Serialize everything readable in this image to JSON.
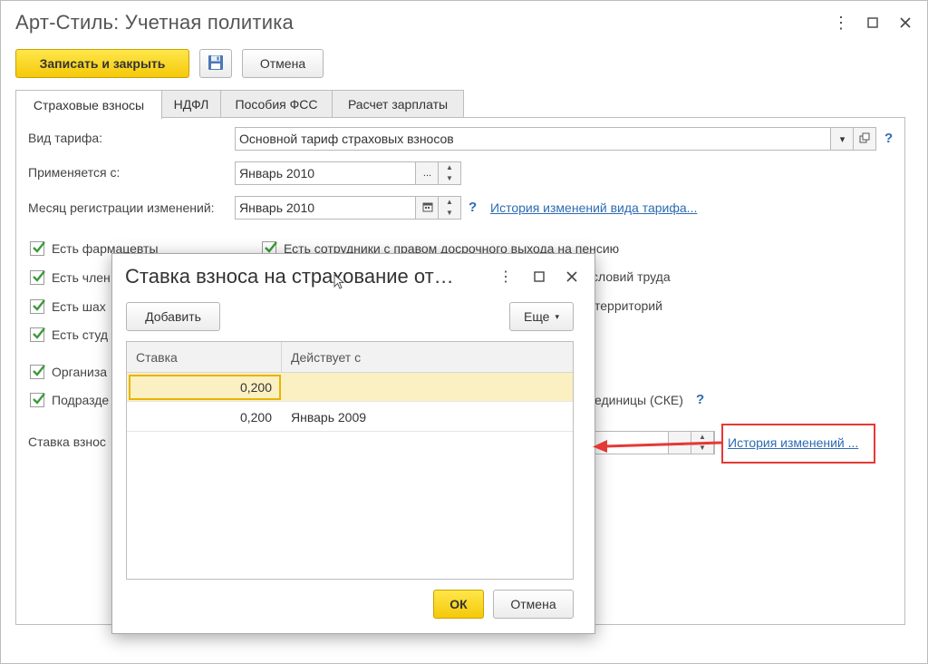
{
  "window": {
    "title": "Арт-Стиль: Учетная политика"
  },
  "toolbar": {
    "save_close_label": "Записать и закрыть",
    "save_icon": "floppy-disk-icon",
    "cancel_label": "Отмена"
  },
  "tabs": [
    {
      "label": "Страховые взносы",
      "active": true
    },
    {
      "label": "НДФЛ",
      "active": false
    },
    {
      "label": "Пособия ФСС",
      "active": false
    },
    {
      "label": "Расчет зарплаты",
      "active": false
    }
  ],
  "form": {
    "tariff_label": "Вид тарифа:",
    "tariff_value": "Основной тариф страховых взносов",
    "applies_label": "Применяется с:",
    "applies_value": "Январь 2010",
    "reg_month_label": "Месяц регистрации изменений:",
    "reg_month_value": "Январь 2010",
    "tariff_history_link": "История изменений вида тарифа...",
    "help": "?",
    "left_checkboxes": [
      {
        "label": "Есть фармацевты",
        "checked": true
      },
      {
        "label": "Есть член",
        "checked": true
      },
      {
        "label": "Есть шах",
        "checked": true
      },
      {
        "label": "Есть студ",
        "checked": true
      },
      {
        "label": "Организа",
        "checked": true
      },
      {
        "label": "Подразде",
        "checked": true
      }
    ],
    "right_checkboxes": [
      {
        "label": "Есть сотрудники с правом досрочного выхода на пенсию",
        "checked": true
      }
    ],
    "right_partial_1": "словий труда",
    "right_partial_2": "территорий",
    "right_partial_3": "единицы (СКЕ)",
    "rate_label": "Ставка взнос",
    "rate_history_link": "История изменений ..."
  },
  "dialog": {
    "title": "Ставка взноса на страхование от…",
    "add_label": "Добавить",
    "more_label": "Еще",
    "columns": [
      "Ставка",
      "Действует с"
    ],
    "rows": [
      {
        "rate": "0,200",
        "from": "",
        "selected": true
      },
      {
        "rate": "0,200",
        "from": "Январь 2009",
        "selected": false
      }
    ],
    "ok_label": "ОК",
    "cancel_label": "Отмена"
  },
  "colors": {
    "primary_button": "#f5c90a",
    "link": "#2d6bb3",
    "checkmark": "#3a9a3a",
    "selected_row": "#fbf0c2",
    "annotation": "#e53935"
  }
}
